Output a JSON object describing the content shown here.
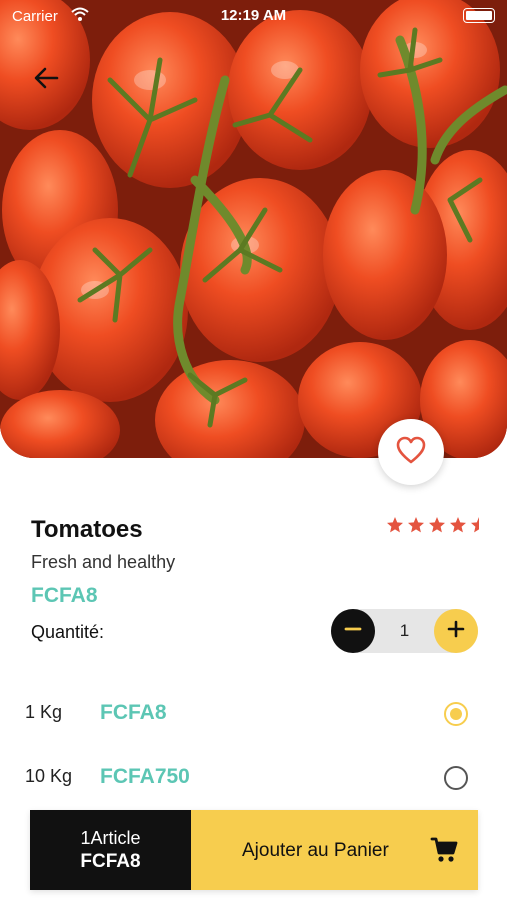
{
  "status_bar": {
    "carrier": "Carrier",
    "time": "12:19 AM"
  },
  "product": {
    "name": "Tomatoes",
    "description": "Fresh and healthy",
    "price": "FCFA8",
    "rating": 4.5,
    "rating_max": 5,
    "favorite": false
  },
  "quantity": {
    "label": "Quantité:",
    "value": "1"
  },
  "options": [
    {
      "weight": "1 Kg",
      "price": "FCFA8",
      "selected": true
    },
    {
      "weight": "10 Kg",
      "price": "FCFA750",
      "selected": false
    }
  ],
  "cart": {
    "count_label": "1Article",
    "total": "FCFA8",
    "add_label": "Ajouter au Panier"
  },
  "colors": {
    "accent_yellow": "#f7cd4e",
    "price_teal": "#5cc6b4",
    "heart_red": "#e4543f",
    "star_red": "#e4543f",
    "dark": "#111111"
  },
  "icons": {
    "back": "arrow-left-icon",
    "favorite": "heart-outline-icon",
    "minus": "minus-icon",
    "plus": "plus-icon",
    "cart": "shopping-cart-icon",
    "wifi": "wifi-icon",
    "battery": "battery-icon"
  }
}
